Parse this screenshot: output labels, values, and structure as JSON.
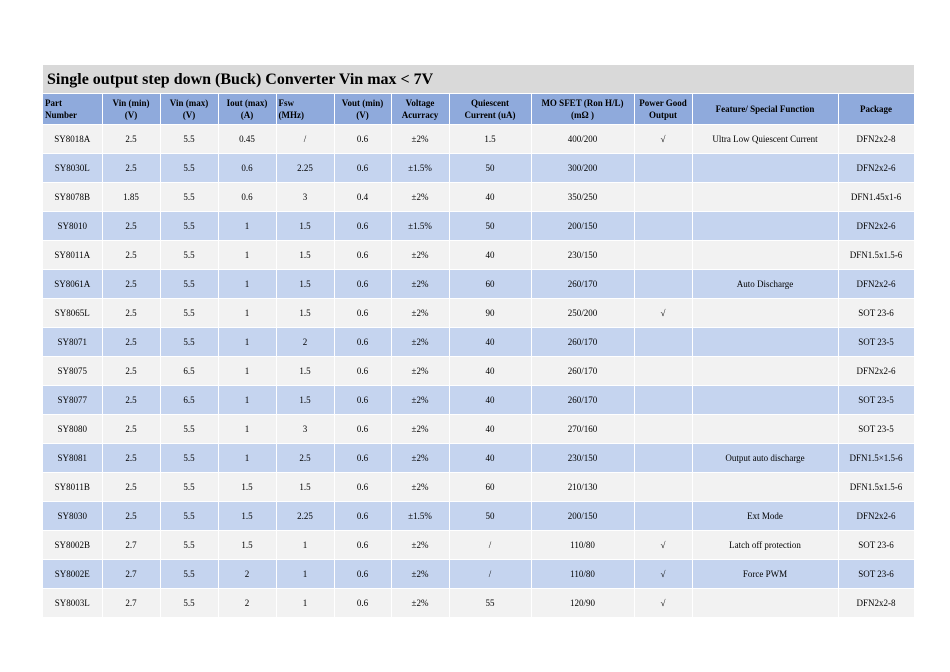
{
  "title": "Single output step down (Buck) Converter Vin max < 7V",
  "columns": [
    [
      "Part",
      "Number"
    ],
    [
      "Vin (min)",
      "(V)"
    ],
    [
      "Vin (max)",
      "(V)"
    ],
    [
      "Iout (max)",
      "(A)"
    ],
    [
      "Fsw",
      "(MHz)"
    ],
    [
      "Vout (min)",
      "(V)"
    ],
    [
      "Voltage",
      "Acurracy"
    ],
    [
      "Quiescent",
      "Current (uA)"
    ],
    [
      "MO SFET (Ron H/L)",
      "(mΩ )"
    ],
    [
      "Power Good",
      "Output"
    ],
    [
      "Feature/ Special Function",
      ""
    ],
    [
      "Package",
      ""
    ]
  ],
  "rows": [
    [
      "SY8018A",
      "2.5",
      "5.5",
      "0.45",
      "/",
      "0.6",
      "±2%",
      "1.5",
      "400/200",
      "√",
      "Ultra Low Quiescent Current",
      "DFN2x2-8"
    ],
    [
      "SY8030L",
      "2.5",
      "5.5",
      "0.6",
      "2.25",
      "0.6",
      "±1.5%",
      "50",
      "300/200",
      "",
      "",
      "DFN2x2-6"
    ],
    [
      "SY8078B",
      "1.85",
      "5.5",
      "0.6",
      "3",
      "0.4",
      "±2%",
      "40",
      "350/250",
      "",
      "",
      "DFN1.45x1-6"
    ],
    [
      "SY8010",
      "2.5",
      "5.5",
      "1",
      "1.5",
      "0.6",
      "±1.5%",
      "50",
      "200/150",
      "",
      "",
      "DFN2x2-6"
    ],
    [
      "SY8011A",
      "2.5",
      "5.5",
      "1",
      "1.5",
      "0.6",
      "±2%",
      "40",
      "230/150",
      "",
      "",
      "DFN1.5x1.5-6"
    ],
    [
      "SY8061A",
      "2.5",
      "5.5",
      "1",
      "1.5",
      "0.6",
      "±2%",
      "60",
      "260/170",
      "",
      "Auto Discharge",
      "DFN2x2-6"
    ],
    [
      "SY8065L",
      "2.5",
      "5.5",
      "1",
      "1.5",
      "0.6",
      "±2%",
      "90",
      "250/200",
      "√",
      "",
      "SOT 23-6"
    ],
    [
      "SY8071",
      "2.5",
      "5.5",
      "1",
      "2",
      "0.6",
      "±2%",
      "40",
      "260/170",
      "",
      "",
      "SOT 23-5"
    ],
    [
      "SY8075",
      "2.5",
      "6.5",
      "1",
      "1.5",
      "0.6",
      "±2%",
      "40",
      "260/170",
      "",
      "",
      "DFN2x2-6"
    ],
    [
      "SY8077",
      "2.5",
      "6.5",
      "1",
      "1.5",
      "0.6",
      "±2%",
      "40",
      "260/170",
      "",
      "",
      "SOT 23-5"
    ],
    [
      "SY8080",
      "2.5",
      "5.5",
      "1",
      "3",
      "0.6",
      "±2%",
      "40",
      "270/160",
      "",
      "",
      "SOT 23-5"
    ],
    [
      "SY8081",
      "2.5",
      "5.5",
      "1",
      "2.5",
      "0.6",
      "±2%",
      "40",
      "230/150",
      "",
      "Output auto discharge",
      "DFN1.5×1.5-6"
    ],
    [
      "SY8011B",
      "2.5",
      "5.5",
      "1.5",
      "1.5",
      "0.6",
      "±2%",
      "60",
      "210/130",
      "",
      "",
      "DFN1.5x1.5-6"
    ],
    [
      "SY8030",
      "2.5",
      "5.5",
      "1.5",
      "2.25",
      "0.6",
      "±1.5%",
      "50",
      "200/150",
      "",
      "Ext Mode",
      "DFN2x2-6"
    ],
    [
      "SY8002B",
      "2.7",
      "5.5",
      "1.5",
      "1",
      "0.6",
      "±2%",
      "/",
      "110/80",
      "√",
      "Latch off protection",
      "SOT 23-6"
    ],
    [
      "SY8002E",
      "2.7",
      "5.5",
      "2",
      "1",
      "0.6",
      "±2%",
      "/",
      "110/80",
      "√",
      "Force PWM",
      "SOT 23-6"
    ],
    [
      "SY8003L",
      "2.7",
      "5.5",
      "2",
      "1",
      "0.6",
      "±2%",
      "55",
      "120/90",
      "√",
      "",
      "DFN2x2-8"
    ]
  ]
}
